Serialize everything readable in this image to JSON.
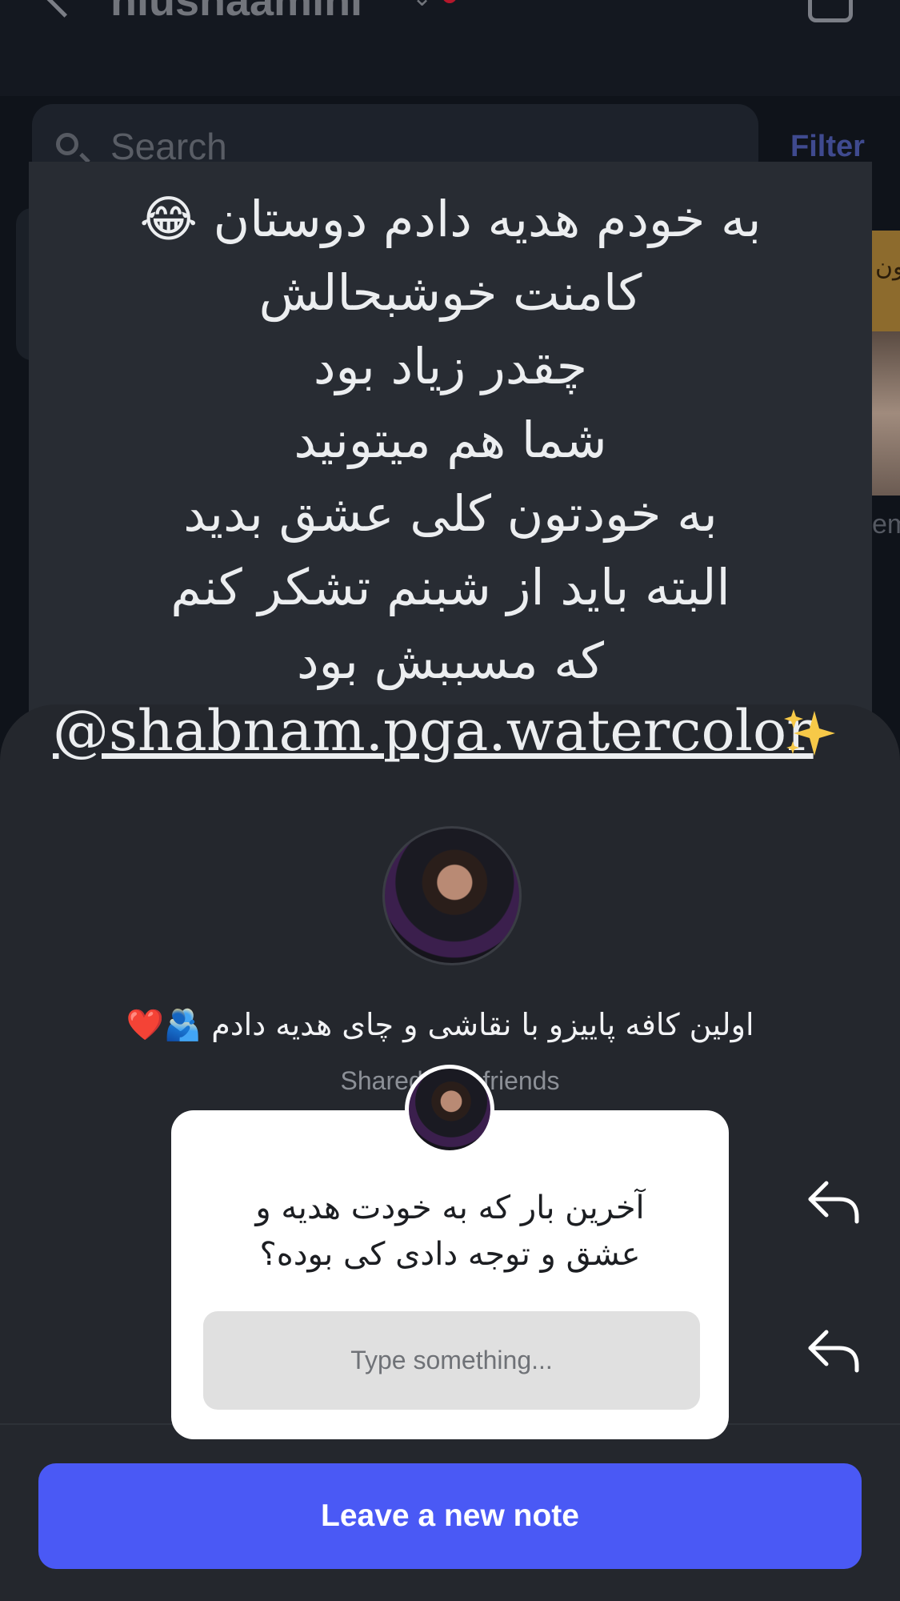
{
  "header": {
    "username": "niushaamini",
    "back_icon": "chevron-left-icon",
    "compose_icon": "compose-icon"
  },
  "search": {
    "placeholder": "Search",
    "filter_label": "Filter",
    "icon": "search-icon"
  },
  "background": {
    "partial_thumb_text": "ون",
    "partial_label": "em"
  },
  "story": {
    "lines": [
      "به خودم هدیه دادم دوستان 😂",
      "کامنت خوشبحالش",
      "چقدر زیاد بود",
      "شما هم میتونید",
      "به خودتون کلی عشق بدید",
      "البته باید از شبنم تشکر کنم",
      "که مسببش بود"
    ],
    "mention": "@shabnam.pga.watercolor",
    "mention_emoji": "sparkles-icon"
  },
  "note": {
    "text": "اولین کافه پاییزو با نقاشی و چای هدیه دادم 🫂❤️",
    "shared_label": "Shared with friends"
  },
  "reply_card": {
    "question_line1": "آخرین بار که به خودت هدیه و",
    "question_line2": "عشق و توجه دادی کی بوده؟",
    "input_placeholder": "Type something..."
  },
  "actions": {
    "reply_icon": "reply-arrow-icon",
    "leave_note_label": "Leave a new note"
  },
  "colors": {
    "accent": "#4a59f5",
    "sheet": "#24272d",
    "story_panel": "#282c33"
  }
}
